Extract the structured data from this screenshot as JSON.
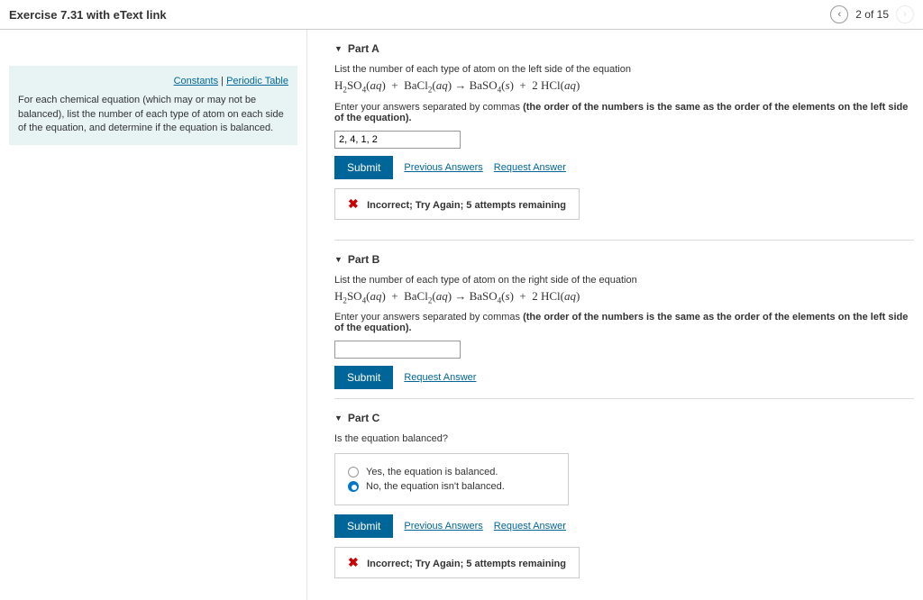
{
  "header": {
    "title": "Exercise 7.31 with eText link",
    "progress": "2 of 15"
  },
  "sidebar": {
    "constants_link": "Constants",
    "periodic_link": "Periodic Table",
    "instructions": "For each chemical equation (which may or may not be balanced), list the number of each type of atom on each side of the equation, and determine if the equation is balanced."
  },
  "partA": {
    "label": "Part A",
    "prompt": "List the number of each type of atom on the left side of the equation",
    "instruction_prefix": "Enter your answers separated by commas ",
    "instruction_bold": "(the order of the numbers is the same as the order of the elements on the left side of the equation).",
    "input_value": "2, 4, 1, 2",
    "submit": "Submit",
    "prev_answers": "Previous Answers",
    "request_answer": "Request Answer",
    "feedback": "Incorrect; Try Again; 5 attempts remaining"
  },
  "partB": {
    "label": "Part B",
    "prompt": "List the number of each type of atom on the right side of the equation",
    "instruction_prefix": "Enter your answers separated by commas ",
    "instruction_bold": "(the order of the numbers is the same as the order of the elements on the left side of the equation).",
    "input_value": "",
    "submit": "Submit",
    "request_answer": "Request Answer"
  },
  "partC": {
    "label": "Part C",
    "prompt": "Is the equation balanced?",
    "option_yes": "Yes, the equation is balanced.",
    "option_no": "No, the equation isn't balanced.",
    "submit": "Submit",
    "prev_answers": "Previous Answers",
    "request_answer": "Request Answer",
    "feedback": "Incorrect; Try Again; 5 attempts remaining"
  }
}
